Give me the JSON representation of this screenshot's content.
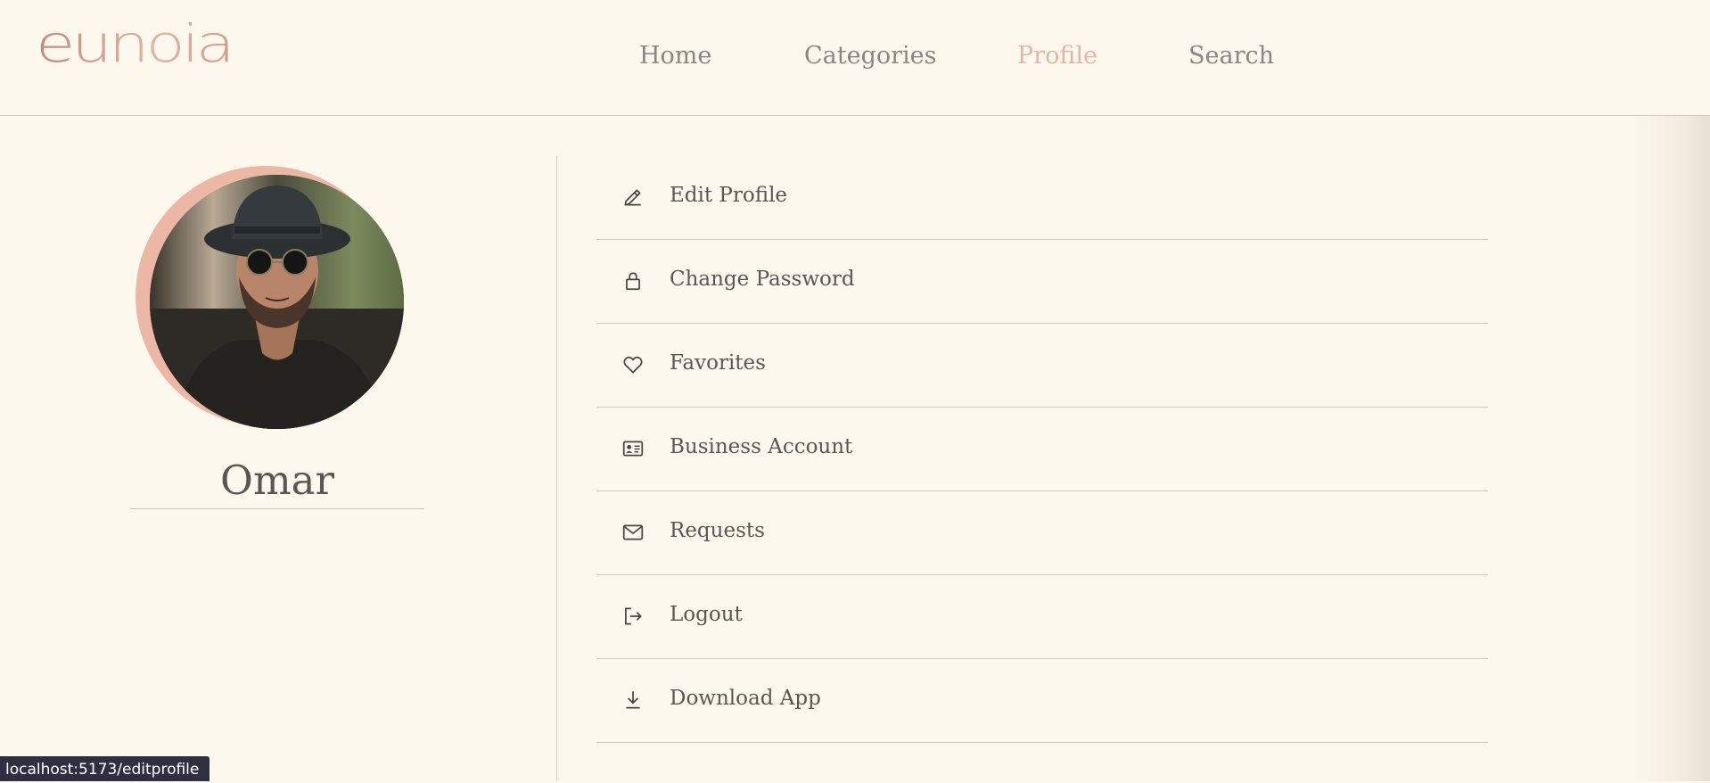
{
  "header": {
    "logo_text": "eunoia",
    "nav": [
      {
        "label": "Home"
      },
      {
        "label": "Categories"
      },
      {
        "label": "Profile"
      },
      {
        "label": "Search"
      }
    ],
    "active_nav": "Profile",
    "accent_color": "#e8b5a3"
  },
  "profile": {
    "name": "Omar"
  },
  "menu": {
    "items": [
      {
        "label": "Edit Profile",
        "icon": "pencil-icon"
      },
      {
        "label": "Change Password",
        "icon": "lock-icon"
      },
      {
        "label": "Favorites",
        "icon": "heart-icon"
      },
      {
        "label": "Business Account",
        "icon": "id-card-icon"
      },
      {
        "label": "Requests",
        "icon": "envelope-icon"
      },
      {
        "label": "Logout",
        "icon": "logout-icon"
      },
      {
        "label": "Download App",
        "icon": "download-icon"
      }
    ]
  },
  "status_bar": {
    "url": "localhost:5173/editprofile"
  }
}
